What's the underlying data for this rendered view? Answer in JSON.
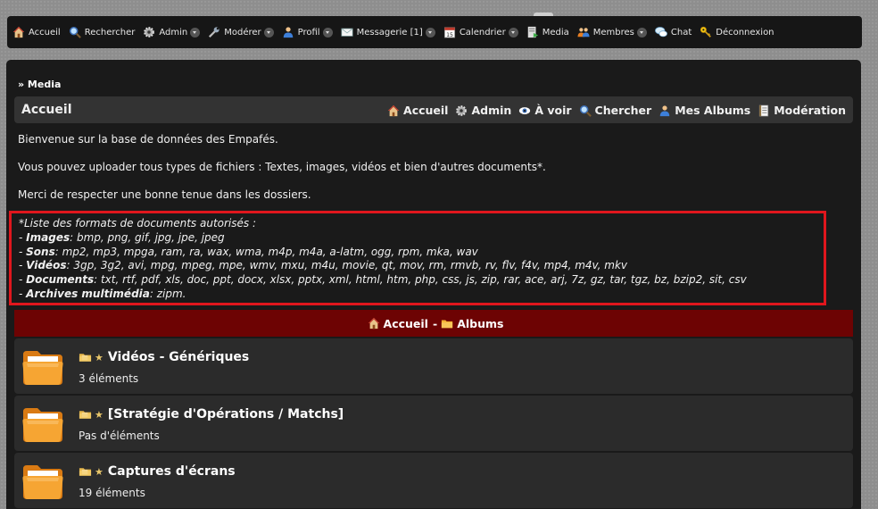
{
  "nav": {
    "items": [
      {
        "label": "Accueil",
        "icon": "home-icon",
        "dropdown": false
      },
      {
        "label": "Rechercher",
        "icon": "search-icon",
        "dropdown": false
      },
      {
        "label": "Admin",
        "icon": "gear-icon",
        "dropdown": true
      },
      {
        "label": "Modérer",
        "icon": "wrench-icon",
        "dropdown": true
      },
      {
        "label": "Profil",
        "icon": "user-icon",
        "dropdown": true
      },
      {
        "label": "Messagerie [1]",
        "icon": "mail-icon",
        "dropdown": true
      },
      {
        "label": "Calendrier",
        "icon": "calendar-icon",
        "dropdown": true
      },
      {
        "label": "Media",
        "icon": "media-icon",
        "dropdown": false
      },
      {
        "label": "Membres",
        "icon": "members-icon",
        "dropdown": true
      },
      {
        "label": "Chat",
        "icon": "chat-icon",
        "dropdown": false
      },
      {
        "label": "Déconnexion",
        "icon": "key-icon",
        "dropdown": false
      }
    ]
  },
  "breadcrumb": "» Media",
  "subbar": {
    "title": "Accueil",
    "links": [
      {
        "label": "Accueil",
        "icon": "home-icon"
      },
      {
        "label": "Admin",
        "icon": "gear-icon"
      },
      {
        "label": "À voir",
        "icon": "eye-icon"
      },
      {
        "label": "Chercher",
        "icon": "search-icon"
      },
      {
        "label": "Mes Albums",
        "icon": "user-icon"
      },
      {
        "label": "Modération",
        "icon": "document-icon"
      }
    ]
  },
  "intro": {
    "line1": "Bienvenue sur la base de données des Empafés.",
    "line2": "Vous pouvez uploader tous types de fichiers : Textes, images, vidéos et bien d'autres documents*.",
    "line3": "Merci de respecter une bonne tenue dans les dossiers."
  },
  "formats": {
    "heading": "*Liste des formats de documents autorisés :",
    "items": [
      {
        "label": "Images",
        "value": ": bmp, png, gif, jpg, jpe, jpeg"
      },
      {
        "label": "Sons",
        "value": ": mp2, mp3, mpga, ram, ra, wax, wma, m4p, m4a, a-latm, ogg, rpm, mka, wav"
      },
      {
        "label": "Vidéos",
        "value": ": 3gp, 3g2, avi, mpg, mpeg, mpe, wmv, mxu, m4u, movie, qt, mov, rm, rmvb, rv, flv, f4v, mp4, m4v, mkv"
      },
      {
        "label": "Documents",
        "value": ": txt, rtf, pdf, xls, doc, ppt, docx, xlsx, pptx, xml, html, htm, php, css, js, zip, rar, ace, arj, 7z, gz, tar, tgz, bz, bzip2, sit, csv"
      },
      {
        "label": "Archives multimédia",
        "value": ": zipm."
      }
    ]
  },
  "album_bar": {
    "home": "Accueil",
    "sep": "-",
    "albums": "Albums"
  },
  "albums": [
    {
      "name": "Vidéos - Génériques",
      "count": "3 éléments"
    },
    {
      "name": "[Stratégie d'Opérations / Matchs]",
      "count": "Pas d'éléments"
    },
    {
      "name": "Captures d'écrans",
      "count": "19 éléments"
    }
  ],
  "colors": {
    "accent_red": "#e0161d",
    "album_bar": "#6d0303",
    "folder": "#f39a2a"
  }
}
